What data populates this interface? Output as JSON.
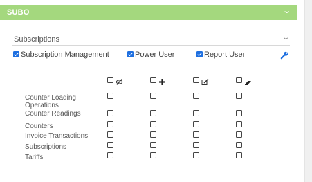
{
  "colors": {
    "header_bg": "#a4d87e",
    "checkbox_checked": "#1e6fe0",
    "accent": "#1e6fe0"
  },
  "header": {
    "title": "SUBO",
    "chevron_icon": "chevron-down-icon"
  },
  "subscriptions_select": {
    "selected": "Subscriptions",
    "chevron_icon": "chevron-down-icon"
  },
  "roles": [
    {
      "label": "Subscription Management",
      "checked": true
    },
    {
      "label": "Power User",
      "checked": true
    },
    {
      "label": "Report User",
      "checked": true
    }
  ],
  "role_settings_icon": "wrench-icon",
  "permission_columns": [
    {
      "icon": "eye-off-icon",
      "header_checked": false
    },
    {
      "icon": "plus-icon",
      "header_checked": false
    },
    {
      "icon": "edit-icon",
      "header_checked": false
    },
    {
      "icon": "eraser-icon",
      "header_checked": false
    }
  ],
  "permission_rows": [
    {
      "label": "Counter Loading Operations",
      "values": [
        false,
        false,
        false,
        false
      ]
    },
    {
      "label": "Counter Readings",
      "values": [
        false,
        false,
        false,
        false
      ]
    },
    {
      "label": "Counters",
      "values": [
        false,
        false,
        false,
        false
      ]
    },
    {
      "label": "Invoice Transactions",
      "values": [
        false,
        false,
        false,
        false
      ]
    },
    {
      "label": "Subscriptions",
      "values": [
        false,
        false,
        false,
        false
      ]
    },
    {
      "label": "Tariffs",
      "values": [
        false,
        false,
        false,
        false
      ]
    }
  ]
}
